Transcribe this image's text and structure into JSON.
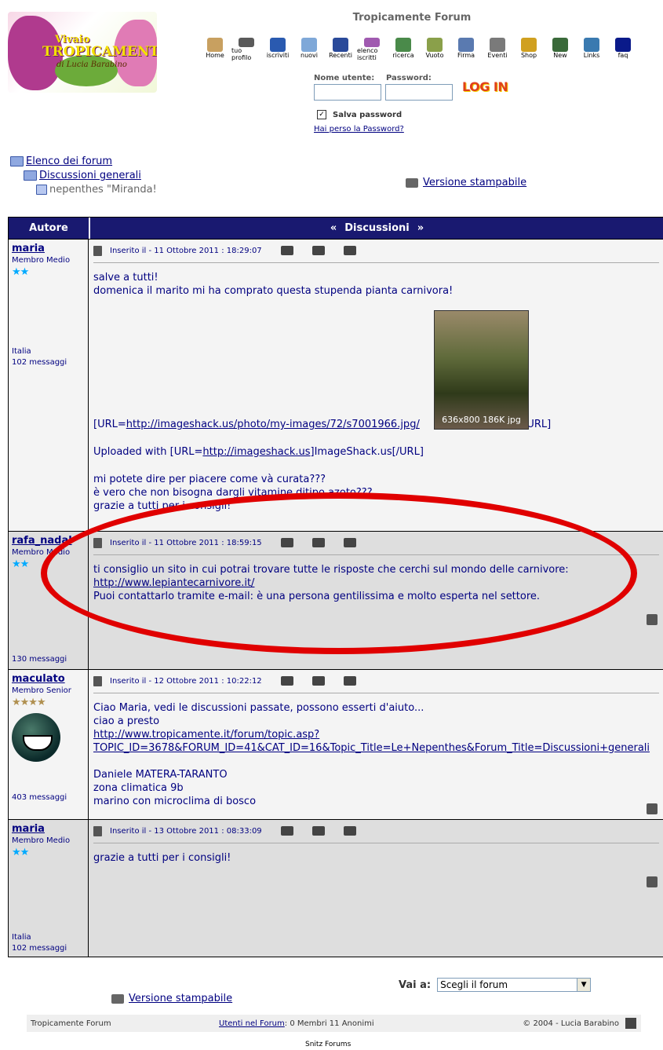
{
  "header": {
    "logo_line1": "Vivaio",
    "logo_line2": "TROPICAMENTE",
    "logo_line3": "di Lucia Barabino",
    "forum_title": "Tropicamente Forum",
    "nav_items": [
      {
        "label": "Home",
        "icon": "home-icon",
        "color": "#c8a060"
      },
      {
        "label": "tuo profilo",
        "icon": "profile-icon",
        "color": "#5a5a5a"
      },
      {
        "label": "iscriviti",
        "icon": "info-icon",
        "color": "#2a5ab0"
      },
      {
        "label": "nuovi",
        "icon": "new-posts-icon",
        "color": "#7fa8d8"
      },
      {
        "label": "Recenti",
        "icon": "recent-icon",
        "color": "#2a4a9a"
      },
      {
        "label": "elenco iscritti",
        "icon": "members-icon",
        "color": "#a05ab0"
      },
      {
        "label": "ricerca",
        "icon": "search-icon",
        "color": "#4a8a4a"
      },
      {
        "label": "Vuoto",
        "icon": "guestbook-icon",
        "color": "#8aa04a"
      },
      {
        "label": "Firma",
        "icon": "sign-icon",
        "color": "#5a7ab0"
      },
      {
        "label": "Eventi",
        "icon": "events-icon",
        "color": "#7a7a7a"
      },
      {
        "label": "Shop",
        "icon": "shop-icon",
        "color": "#d0a020"
      },
      {
        "label": "New",
        "icon": "new-icon",
        "color": "#3a6a3a"
      },
      {
        "label": "Links",
        "icon": "globe-icon",
        "color": "#3a7ab0"
      },
      {
        "label": "faq",
        "icon": "faq-icon",
        "color": "#0a1a8a"
      }
    ],
    "username_label": "Nome utente:",
    "password_label": "Password:",
    "login_label": "LOG IN",
    "save_password_label": "Salva password",
    "lost_password_link": "Hai perso la Password?"
  },
  "breadcrumb": {
    "level1": "Elenco dei forum",
    "level2": "Discussioni generali",
    "level3": "nepenthes \"Miranda!"
  },
  "print_link": "Versione stampabile",
  "table": {
    "col_author": "Autore",
    "col_topic": "Discussioni",
    "posts": [
      {
        "author": "maria",
        "rank": "Membro Medio",
        "stars": "★★",
        "star_color": "#00aaff",
        "country": "Italia",
        "messages": "102 messaggi",
        "date": "Inserito il - 11 Ottobre 2011 :  18:29:07",
        "lines": [
          "salve a tutti!",
          "domenica il marito mi ha comprato questa stupenda pianta carnivora!",
          "[URL=",
          "http://imageshack.us/photo/my-images/72/s7001966.jpg/",
          "][/URL]",
          "Uploaded with [URL=",
          "http://imageshack.us",
          "]ImageShack.us[/URL]",
          "mi potete dire per piacere come và curata???",
          "è vero che non bisogna dargli vitamine ditipo azoto???",
          "grazie a tutti per i consigli!"
        ],
        "image_caption": "636x800 186K jpg"
      },
      {
        "author": "rafa_nadal",
        "rank": "Membro Medio",
        "stars": "★★",
        "star_color": "#00aaff",
        "messages": "130 messaggi",
        "date": "Inserito il - 11 Ottobre 2011 :  18:59:15",
        "lines": [
          "ti consiglio un sito in cui potrai trovare tutte le risposte che cerchi sul mondo delle carnivore:",
          "http://www.lepiantecarnivore.it/",
          "Puoi contattarlo tramite e-mail: è una persona gentilissima e molto esperta nel settore."
        ]
      },
      {
        "author": "maculato",
        "rank": "Membro Senior",
        "stars": "★★★★",
        "star_color": "#b09050",
        "messages": "403 messaggi",
        "date": "Inserito il - 12 Ottobre 2011 :  10:22:12",
        "lines": [
          "Ciao Maria, vedi le discussioni passate, possono esserti d'aiuto...",
          "ciao a presto",
          "http://www.tropicamente.it/forum/topic.asp?",
          "TOPIC_ID=3678&FORUM_ID=41&CAT_ID=16&Topic_Title=Le+Nepenthes&Forum_Title=Discussioni+generali",
          "Daniele MATERA-TARANTO",
          "zona climatica 9b",
          "marino con microclima di bosco"
        ]
      },
      {
        "author": "maria",
        "rank": "Membro Medio",
        "stars": "★★",
        "star_color": "#00aaff",
        "country": "Italia",
        "messages": "102 messaggi",
        "date": "Inserito il - 13 Ottobre 2011 :  08:33:09",
        "lines": [
          "grazie a tutti per i consigli!"
        ]
      }
    ]
  },
  "bottom": {
    "print_link": "Versione stampabile",
    "goto_label": "Vai a:",
    "goto_select": "Scegli il forum",
    "footer_forum": "Tropicamente Forum",
    "footer_online_link": "Utenti nel Forum",
    "footer_online_text": ": 0 Membri  11 Anonimi",
    "footer_copyright": "© 2004 - Lucia Barabino",
    "powered": "Snitz Forums"
  }
}
